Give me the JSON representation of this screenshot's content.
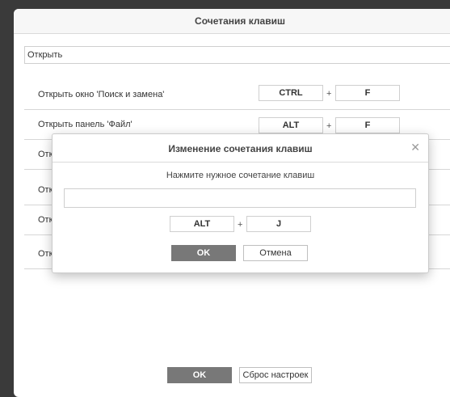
{
  "window": {
    "title": "Сочетания клавиш"
  },
  "combo": {
    "value": "Открыть"
  },
  "rows": [
    {
      "label": "Открыть окно 'Поиск и замена'",
      "key1": "CTRL",
      "key2": "F"
    },
    {
      "label": "Открыть панель 'Файл'",
      "key1": "ALT",
      "key2": "F"
    },
    {
      "label": "Отк"
    },
    {
      "label": "Отк"
    },
    {
      "label": "Отк"
    },
    {
      "label": "Отк"
    }
  ],
  "footer": {
    "ok_label": "OK",
    "reset_label": "Сброс настроек"
  },
  "dialog": {
    "title": "Изменение сочетания клавиш",
    "hint": "Нажмите нужное сочетание клавиш",
    "input_value": "",
    "key1": "ALT",
    "plus": "+",
    "key2": "J",
    "ok_label": "OK",
    "cancel_label": "Отмена"
  },
  "plus": "+",
  "icons": {
    "close": "close-icon"
  }
}
